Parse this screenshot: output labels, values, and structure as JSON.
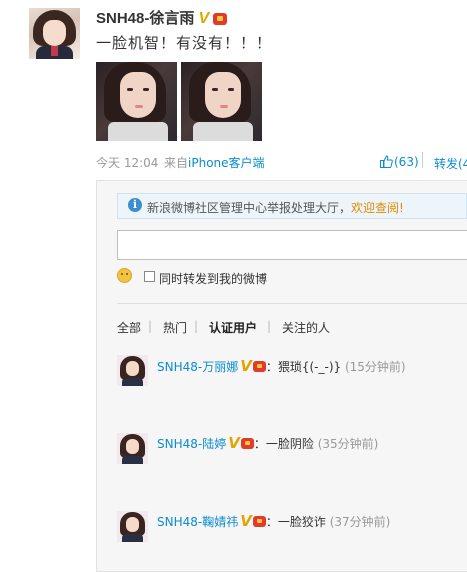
{
  "post": {
    "author": "SNH48-徐言雨",
    "badge_v": "V",
    "text": "一脸机智！有没有！！！",
    "photos": [
      "photo-1",
      "photo-2"
    ],
    "time": "今天 12:04",
    "from_prefix": "来自",
    "from_source": "iPhone客户端",
    "like_count": "(63)",
    "forward_label": "转发(4"
  },
  "comments_panel": {
    "notice_text": "新浪微博社区管理中心举报处理大厅，",
    "notice_link": "欢迎查阅!",
    "input_placeholder": "",
    "forward_checkbox_label": "同时转发到我的微博",
    "filters": [
      "全部",
      "热门",
      "认证用户",
      "关注的人"
    ],
    "active_filter": "认证用户",
    "separator": "|",
    "comments": [
      {
        "name": "SNH48-万丽娜",
        "badge_v": "V",
        "colon": "：",
        "text": "猥琐{(-_-)}",
        "time": "(15分钟前)"
      },
      {
        "name": "SNH48-陆婷",
        "badge_v": "V",
        "colon": "：",
        "text": "一脸阴险",
        "time": "(35分钟前)"
      },
      {
        "name": "SNH48-鞠婧祎",
        "badge_v": "V",
        "colon": "：",
        "text": "一脸狡诈",
        "time": "(37分钟前)"
      }
    ]
  },
  "colors": {
    "link_blue": "#0a8cd2",
    "verified_gold": "#e0a500",
    "notice_orange": "#e08a00"
  },
  "icons": [
    "v-verified-icon",
    "crown-icon",
    "thumbs-up-icon",
    "info-icon",
    "emoji-icon"
  ]
}
